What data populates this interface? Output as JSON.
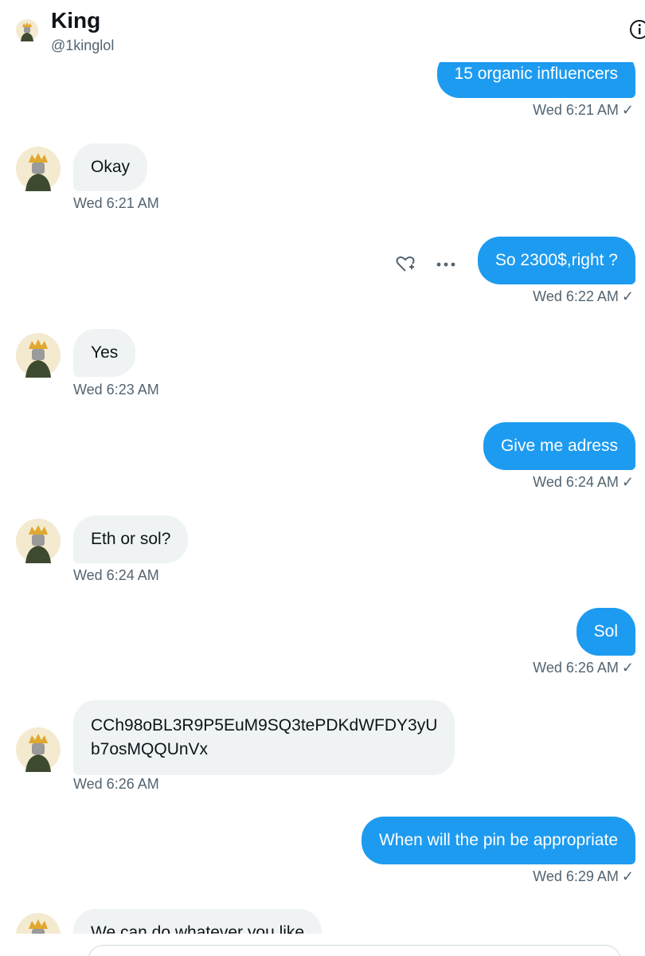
{
  "header": {
    "name": "King",
    "handle": "@1kinglol"
  },
  "messages": [
    {
      "text": "15 organic influencers",
      "time": "Wed 6:21 AM"
    },
    {
      "text": "Okay",
      "time": "Wed 6:21 AM"
    },
    {
      "text": "So 2300$,right ?",
      "time": "Wed 6:22 AM"
    },
    {
      "text": "Yes",
      "time": "Wed 6:23 AM"
    },
    {
      "text": "Give me adress",
      "time": "Wed 6:24 AM"
    },
    {
      "text": "Eth or sol?",
      "time": "Wed 6:24 AM"
    },
    {
      "text": "Sol",
      "time": "Wed 6:26 AM"
    },
    {
      "text_line1": "CCh98oBL3R9P5EuM9SQ3tePDKdWFDY3yU",
      "text_line2": "b7osMQQUnVx",
      "time": "Wed 6:26 AM"
    },
    {
      "text": "When will the pin be appropriate",
      "time": "Wed 6:29 AM"
    },
    {
      "text": "We can do whatever you like"
    }
  ],
  "colors": {
    "sent_bubble": "#1d9bf0",
    "received_bubble": "#eff3f4",
    "timestamp": "#536471"
  },
  "icons": {
    "read_receipt": "check-icon",
    "reaction": "heart-plus-icon",
    "more": "more-icon",
    "info": "info-icon"
  }
}
